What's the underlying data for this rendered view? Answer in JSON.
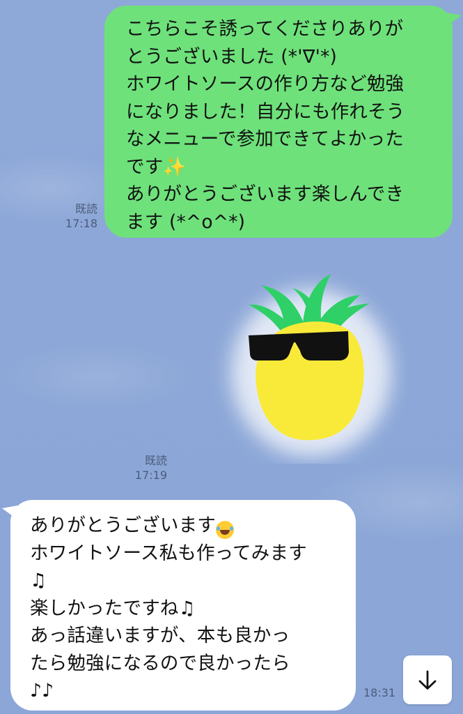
{
  "messages": {
    "outgoing": {
      "lines": [
        "こちらこそ誘ってくださりありが",
        "とうございました (*'∇'*)",
        "ホワイトソースの作り方など勉強",
        "になりました！自分にも作れそう",
        "なメニューで参加できてよかった",
        "です",
        "ありがとうございます楽しんでき",
        "ます (*^o^*)"
      ],
      "sparkle_emoji": "✨",
      "read_label": "既読",
      "time": "17:18"
    },
    "sticker": {
      "icon": "pineapple-sunglasses-sticker",
      "read_label": "既読",
      "time": "17:19"
    },
    "incoming": {
      "lines": [
        "ありがとうございます",
        "ホワイトソース私も作ってみます",
        "",
        "楽しかったですね",
        "あっ話違いますが、本も良かっ",
        "たら勉強になるので良かったら",
        ""
      ],
      "laugh_emoji": "😂",
      "note_emoji": "♫",
      "notes_emoji": "♪♪",
      "time": "18:31"
    }
  },
  "colors": {
    "chat_background": "#8fa9d8",
    "outgoing_bubble": "#6ee17b",
    "incoming_bubble": "#ffffff"
  },
  "controls": {
    "scroll_down_icon": "arrow-down-icon"
  }
}
